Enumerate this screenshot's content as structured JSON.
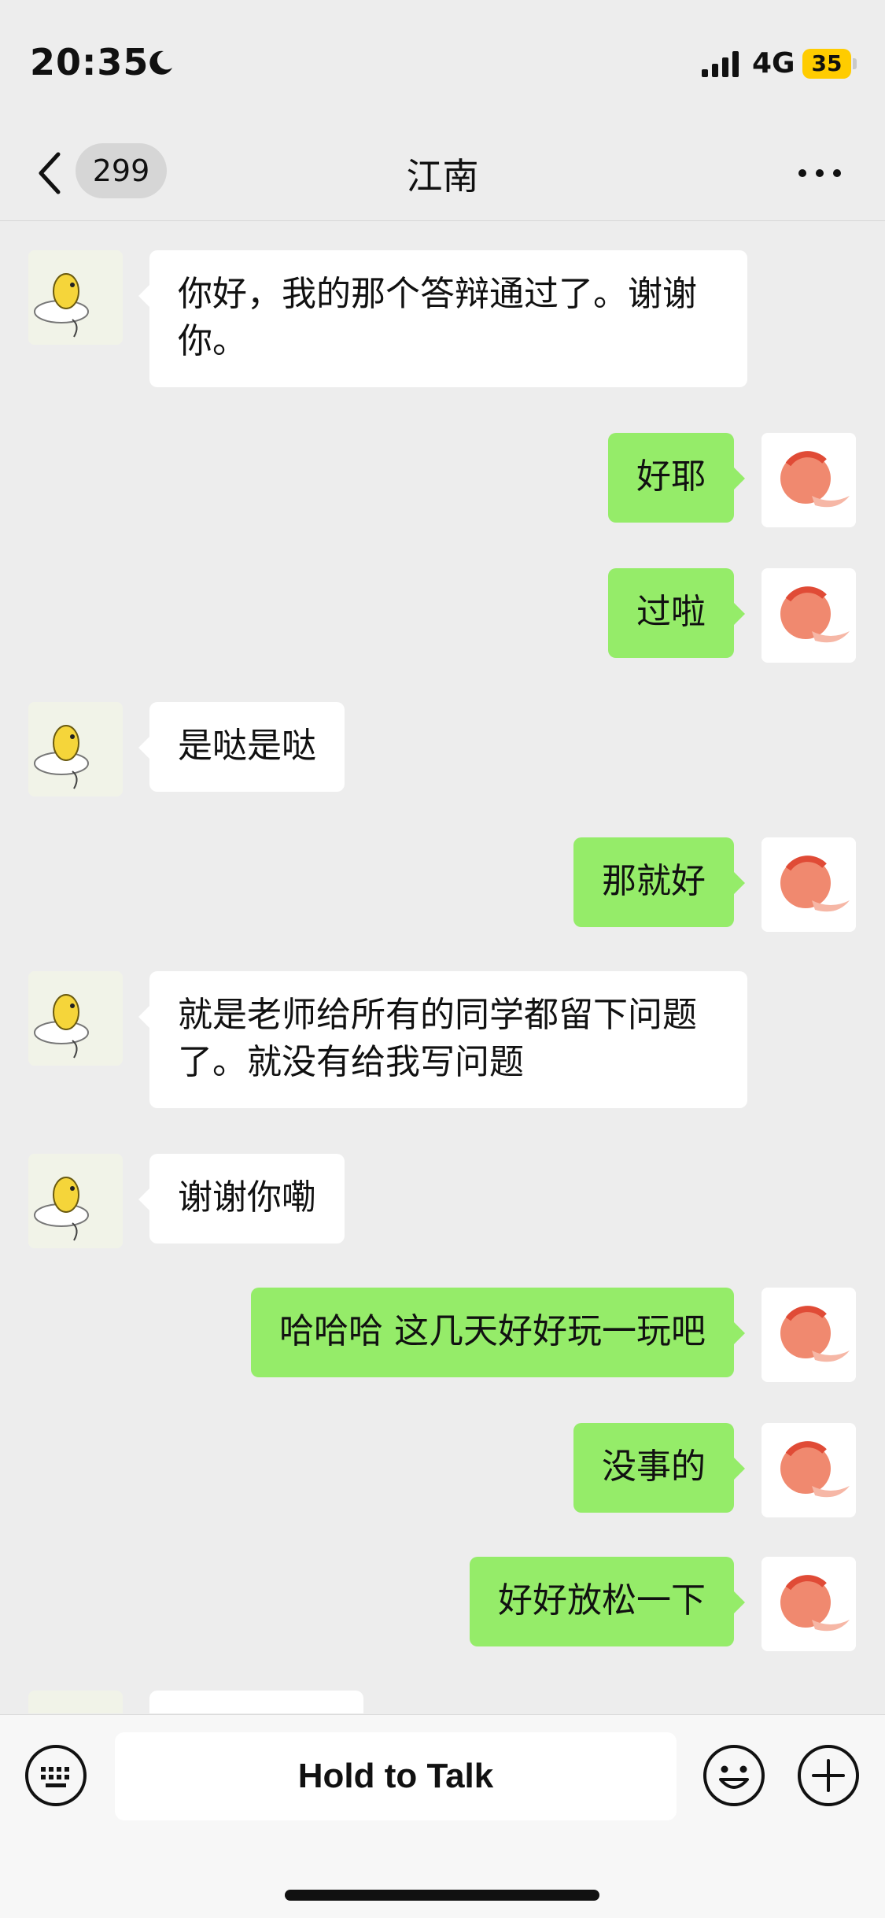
{
  "status_bar": {
    "time": "20:35",
    "network": "4G",
    "battery": "35"
  },
  "header": {
    "unread_count": "299",
    "title": "江南"
  },
  "messages": [
    {
      "side": "left",
      "text": "你好，我的那个答辩通过了。谢谢你。"
    },
    {
      "side": "right",
      "text": "好耶"
    },
    {
      "side": "right",
      "text": "过啦"
    },
    {
      "side": "left",
      "text": "是哒是哒"
    },
    {
      "side": "right",
      "text": "那就好"
    },
    {
      "side": "left",
      "text": "就是老师给所有的同学都留下问题了。就没有给我写问题"
    },
    {
      "side": "left",
      "text": "谢谢你嘞"
    },
    {
      "side": "right",
      "text": "哈哈哈 这几天好好玩一玩吧"
    },
    {
      "side": "right",
      "text": "没事的"
    },
    {
      "side": "right",
      "text": "好好放松一下"
    }
  ],
  "input_bar": {
    "hold_to_talk_label": "Hold to Talk"
  },
  "icons": {
    "back": "chevron-left-icon",
    "more": "more-dots-icon",
    "keyboard": "keyboard-icon",
    "emoji": "smiley-icon",
    "plus": "plus-icon"
  },
  "colors": {
    "sent_bubble": "#95ec69",
    "received_bubble": "#ffffff",
    "background": "#ededed",
    "battery": "#ffcc00"
  }
}
